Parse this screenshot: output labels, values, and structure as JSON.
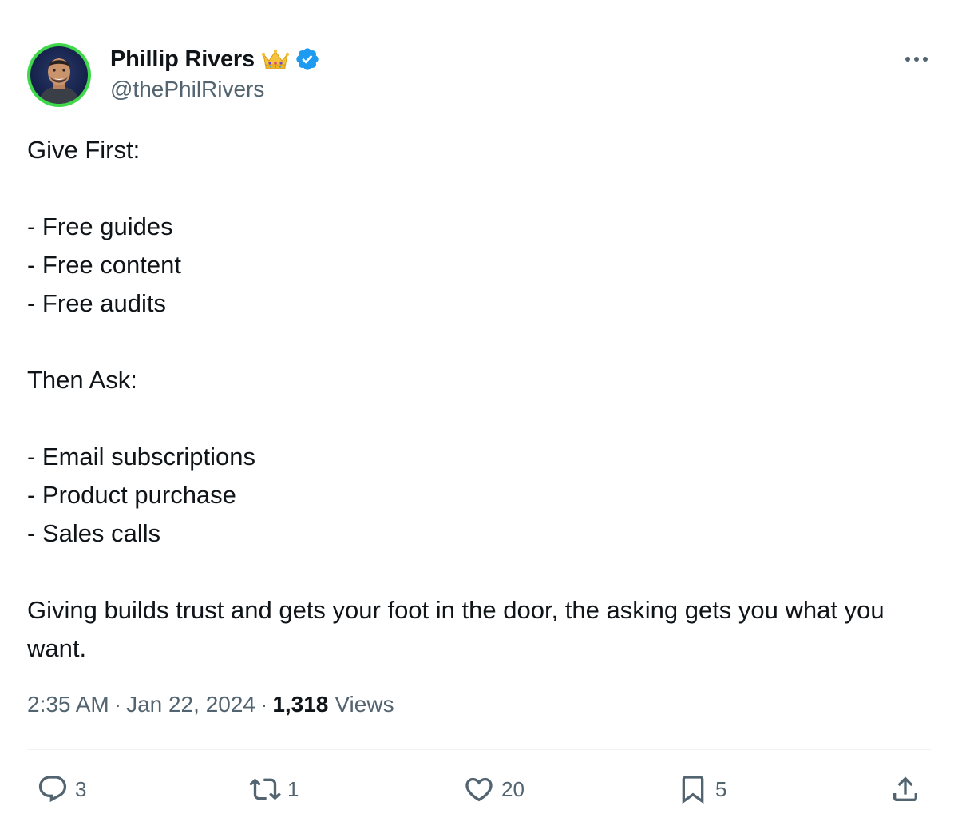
{
  "author": {
    "display_name": "Phillip Rivers",
    "handle": "@thePhilRivers",
    "avatar_ring_color": "#3fd84a",
    "verified_color": "#1d9bf0",
    "badge_icon": "crown-emoji-icon"
  },
  "tweet": {
    "lines": [
      "Give First:",
      "",
      "- Free guides",
      "- Free content",
      "- Free audits",
      "",
      "Then Ask:",
      "",
      "- Email subscriptions",
      "- Product purchase",
      "- Sales calls",
      "",
      "Giving builds trust and gets your foot in the door, the asking gets you what you want."
    ]
  },
  "meta": {
    "time": "2:35 AM",
    "separator": "·",
    "date": "Jan 22, 2024",
    "views_count": "1,318",
    "views_label": "Views"
  },
  "actions": {
    "reply": {
      "icon": "reply-icon",
      "count": "3"
    },
    "retweet": {
      "icon": "retweet-icon",
      "count": "1"
    },
    "like": {
      "icon": "heart-icon",
      "count": "20"
    },
    "bookmark": {
      "icon": "bookmark-icon",
      "count": "5"
    },
    "share": {
      "icon": "share-icon"
    }
  },
  "colors": {
    "text_primary": "#0f1419",
    "text_secondary": "#536471",
    "divider": "#eff3f4"
  }
}
